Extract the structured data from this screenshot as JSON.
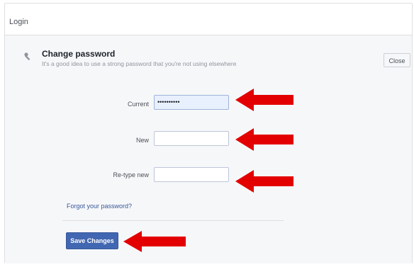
{
  "section": {
    "title": "Login"
  },
  "change_password": {
    "icon": "key-icon",
    "title": "Change password",
    "subtitle": "It's a good idea to use a strong password that you're not using elsewhere",
    "close_label": "Close"
  },
  "form": {
    "current_label": "Current",
    "current_value": "••••••••••",
    "new_label": "New",
    "new_value": "",
    "retype_label": "Re-type new",
    "retype_value": "",
    "forgot_link": "Forgot your password?",
    "save_label": "Save Changes"
  },
  "annotations": {
    "arrow_color": "#e30000"
  },
  "colors": {
    "accent": "#4267b2",
    "link": "#385898",
    "row_background": "#f6f7f9"
  }
}
